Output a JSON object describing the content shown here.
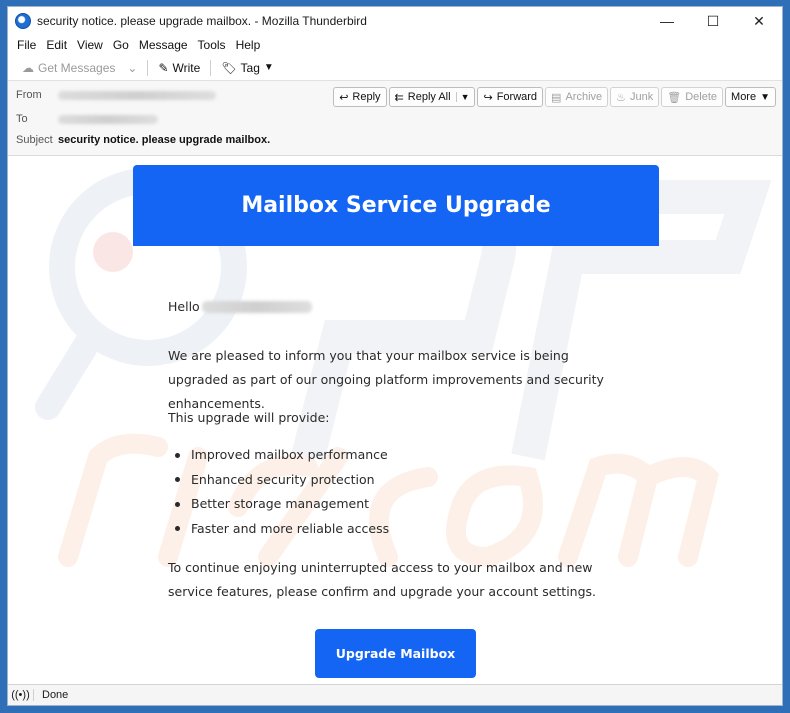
{
  "window": {
    "title": "security notice. please upgrade mailbox. - Mozilla Thunderbird",
    "controls": {
      "minimize": "—",
      "maximize": "☐",
      "close": "✕"
    }
  },
  "menu": [
    "File",
    "Edit",
    "View",
    "Go",
    "Message",
    "Tools",
    "Help"
  ],
  "toolbar": {
    "get_messages": "Get Messages",
    "write": "Write",
    "tag": "Tag"
  },
  "header": {
    "from_label": "From",
    "to_label": "To",
    "subject_label": "Subject",
    "subject": "security notice. please upgrade mailbox.",
    "actions": {
      "reply": "Reply",
      "reply_all": "Reply All",
      "forward": "Forward",
      "archive": "Archive",
      "junk": "Junk",
      "delete": "Delete",
      "more": "More"
    }
  },
  "email": {
    "banner_title": "Mailbox Service Upgrade",
    "greeting": "Hello",
    "paragraph1": "We are pleased to inform you that your mailbox service is being upgraded as part of our ongoing platform improvements and security enhancements.",
    "paragraph2": "This upgrade will provide:",
    "benefits": [
      "Improved mailbox performance",
      "Enhanced security protection",
      "Better storage management",
      "Faster and more reliable access"
    ],
    "paragraph3": "To continue enjoying uninterrupted access to your mailbox and new service features, please confirm and upgrade your account settings.",
    "cta_label": "Upgrade Mailbox",
    "brand_color": "#1565f5"
  },
  "status": {
    "text": "Done"
  }
}
